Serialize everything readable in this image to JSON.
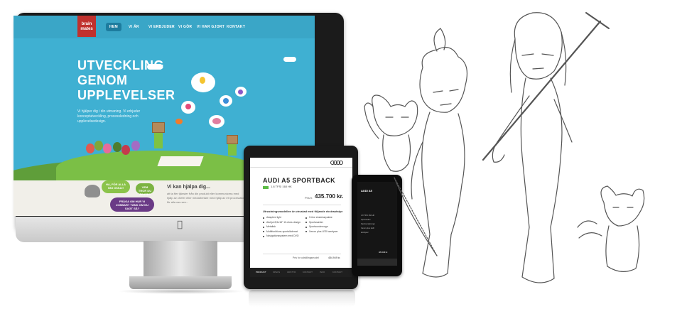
{
  "website": {
    "logo_lines": [
      "brain",
      "mates"
    ],
    "nav": [
      "HEM",
      "VI ÄR",
      "VI ERBJUDER",
      "VI GÖR",
      "VI HAR GJORT",
      "KONTAKT"
    ],
    "hero_title_lines": [
      "UTVECKLING",
      "GENOM",
      "UPPLEVELSER"
    ],
    "hero_text": "Vi hjälper dig i din utmaning. Vi erbjuder konceptutveckling, processledning och upplevelsedesign.",
    "speech_1": "HA, FÖR ALLA NNI OSSA!!",
    "speech_2": "VEM TROR DU ÄR ITE?",
    "speech_3": "FRÅGA OM HUR VI JOBBAR? TÄNK OM DU SAGT SÅ?",
    "help_title": "Vi kan hjälpa dig...",
    "help_text": "att ta fler tjänster från din produkt eller kommunicera med hjälp av chefer eller medarbetare med hjälp av ett processtöd för alla oss sen..."
  },
  "ipad_app": {
    "title": "AUDI A5 SPORTBACK",
    "engine": "1.8 TFSI 160 HK",
    "price_label": "Pris fr.",
    "price": "435.700 kr.",
    "equipment_title": "Utrustningsmodellen är utrustad med följande ekstrautstyr:",
    "equipment_left": [
      "Adaptive light",
      "Aluhjul 8,5x18\" 10-ekes design",
      "Metallak",
      "Multifunktions-sportsläderrat",
      "Navigationssystem med DVD"
    ],
    "equipment_right": [
      "S-line eksteriørpakke",
      "Sportssæder",
      "Sportsundervogn",
      "Xenon plus LED kørelyser"
    ],
    "total_label": "Pris for udstillingsmodel",
    "total_value": "484.949 kr.",
    "tabs": [
      "PRODUKT",
      "SPECS",
      "UDSTYR",
      "KONTAKT",
      "INFO",
      "KONTAKT"
    ]
  },
  "iphone_app": {
    "title": "AUDI A5",
    "rows": [
      "1.8 TFSI 160 HK",
      "Sportsæder",
      "Sportsundervogn",
      "Xenon plus LED",
      "kørelyser"
    ],
    "price": "484.949 kr."
  },
  "colors": {
    "site_sky": "#3fb0d2",
    "logo_red": "#c0312e",
    "grass": "#7bbf46",
    "audi_green": "#5cbb46"
  }
}
